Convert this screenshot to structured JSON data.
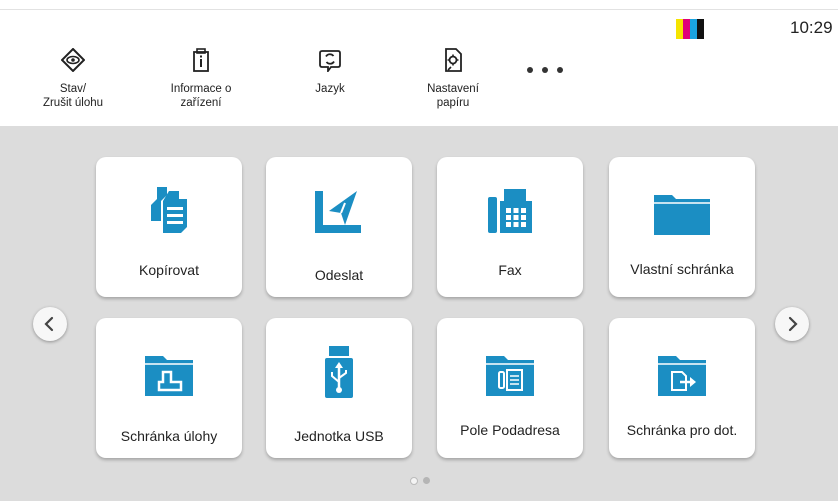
{
  "status_bar": {
    "time": "10:29",
    "toner_colors": [
      "#f5e400",
      "#e0007a",
      "#1aa3e0",
      "#111111"
    ]
  },
  "header": {
    "items": [
      {
        "label_line1": "Stav/",
        "label_line2": "Zrušit úlohu",
        "icon": "eye-diamond-icon"
      },
      {
        "label_line1": "Informace o",
        "label_line2": "zařízení",
        "icon": "device-info-icon"
      },
      {
        "label_line1": "Jazyk",
        "label_line2": "",
        "icon": "language-icon"
      },
      {
        "label_line1": "Nastavení",
        "label_line2": "papíru",
        "icon": "paper-settings-icon"
      }
    ],
    "more_icon": "more-dots-icon"
  },
  "tiles": [
    {
      "label": "Kopírovat",
      "icon": "copy-icon"
    },
    {
      "label": "Odeslat",
      "icon": "send-icon"
    },
    {
      "label": "Fax",
      "icon": "fax-icon"
    },
    {
      "label": "Vlastní schránka",
      "icon": "folder-icon"
    },
    {
      "label": "Schránka úlohy",
      "icon": "job-box-icon"
    },
    {
      "label": "Jednotka USB",
      "icon": "usb-icon"
    },
    {
      "label": "Pole Podadresa",
      "icon": "subaddress-box-icon"
    },
    {
      "label": "Schránka pro dot.",
      "icon": "polling-box-icon"
    }
  ],
  "pagination": {
    "current_page": 1,
    "total_pages": 2
  },
  "colors": {
    "accent": "#1b8ec3",
    "background": "#dcdcdc"
  }
}
